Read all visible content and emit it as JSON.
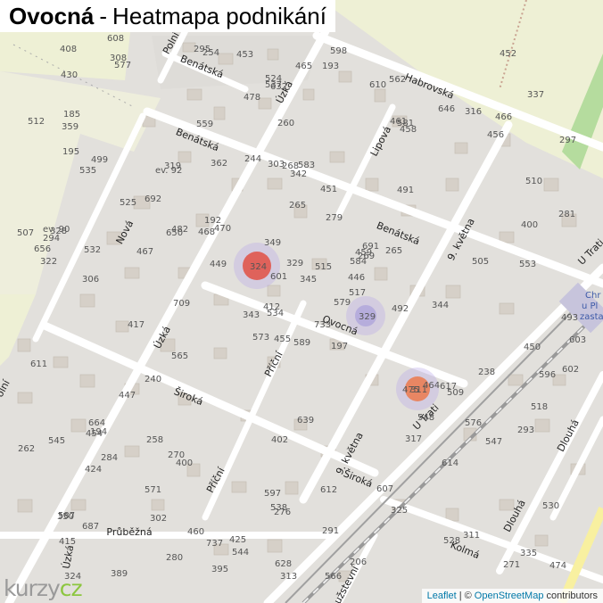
{
  "header": {
    "place": "Ovocná",
    "separator": "-",
    "subtitle": "Heatmapa podnikání"
  },
  "attribution": {
    "leaflet": "Leaflet",
    "separator": "|",
    "copyright": "©",
    "osm": "OpenStreetMap",
    "contributors": "contributors"
  },
  "logo": {
    "main": "kurzy",
    "suffix": "cz"
  },
  "streets": [
    {
      "name": "Polní"
    },
    {
      "name": "Benátská"
    },
    {
      "name": "Benátská"
    },
    {
      "name": "Benátská"
    },
    {
      "name": "Úzká"
    },
    {
      "name": "Úzká"
    },
    {
      "name": "Úzká"
    },
    {
      "name": "Habrovská"
    },
    {
      "name": "Lipová"
    },
    {
      "name": "Nová"
    },
    {
      "name": "Ovocná"
    },
    {
      "name": "Příční"
    },
    {
      "name": "Příční"
    },
    {
      "name": "Široká"
    },
    {
      "name": "Široká"
    },
    {
      "name": "9. května"
    },
    {
      "name": "9. května"
    },
    {
      "name": "U Trati"
    },
    {
      "name": "U Trati"
    },
    {
      "name": "Průběžná"
    },
    {
      "name": "Dlouhá"
    },
    {
      "name": "Dlouhá"
    },
    {
      "name": "Kolmá"
    },
    {
      "name": "Polní"
    },
    {
      "name": "Lužstevní"
    }
  ],
  "house_numbers": [
    "589",
    "535",
    "534",
    "587",
    "584",
    "400",
    "562",
    "583",
    "581",
    "579",
    "577",
    "474",
    "306",
    "297",
    "573",
    "491",
    "389",
    "303",
    "279",
    "284",
    "470",
    "415",
    "302",
    "268",
    "269",
    "509",
    "499",
    "632",
    "322",
    "475",
    "281",
    "412",
    "597",
    "601",
    "319",
    "646",
    "270",
    "271",
    "530",
    "617",
    "598",
    "468",
    "467",
    "317",
    "280",
    "507",
    "446",
    "324",
    "276",
    "517",
    "424",
    "510",
    "512",
    "548",
    "325",
    "571",
    "308",
    "408",
    "612",
    "466",
    "465",
    "709",
    "328",
    "692",
    "316",
    "608",
    "610",
    "478",
    "329",
    "262",
    "402",
    "737",
    "464",
    "650",
    "350",
    "430",
    "525",
    "611",
    "349",
    "291",
    "515",
    "687",
    "492",
    "518",
    "628",
    "553",
    "639",
    "311",
    "566",
    "607",
    "524",
    "603",
    "265",
    "614",
    "345",
    "293",
    "294",
    "313",
    "461",
    "458",
    "417",
    "295",
    "493",
    "656",
    "447",
    "258",
    "460",
    "459",
    "456",
    "449",
    "450",
    "359",
    "342",
    "343",
    "254",
    "545",
    "455",
    "337",
    "244",
    "453",
    "454",
    "452",
    "451",
    "362",
    "344",
    "240",
    "335",
    "544",
    "505",
    "195",
    "194",
    "206",
    "482",
    "559",
    "596",
    "576",
    "565",
    "664",
    "602",
    "192",
    "197",
    "532",
    "547",
    "733",
    "691",
    "185",
    "425",
    "528",
    "538",
    "537",
    "400",
    "ev. 92",
    "ev. 90",
    "395",
    "238",
    "193",
    "260",
    "265"
  ],
  "heat_labels": [
    "324",
    "329",
    "311"
  ],
  "poi": [
    "Chr",
    "u Pl",
    "zasta"
  ]
}
